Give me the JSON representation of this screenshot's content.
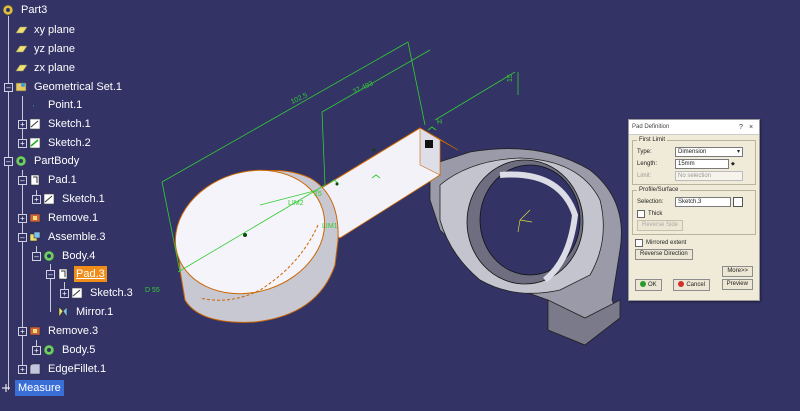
{
  "tree": {
    "items": [
      {
        "label": "Part3"
      },
      {
        "label": "xy plane"
      },
      {
        "label": "yz plane"
      },
      {
        "label": "zx plane"
      },
      {
        "label": "Geometrical Set.1"
      },
      {
        "label": "Point.1"
      },
      {
        "label": "Sketch.1"
      },
      {
        "label": "Sketch.2"
      },
      {
        "label": "PartBody"
      },
      {
        "label": "Pad.1"
      },
      {
        "label": "Sketch.1"
      },
      {
        "label": "Remove.1"
      },
      {
        "label": "Assemble.3"
      },
      {
        "label": "Body.4"
      },
      {
        "label": "Pad.3"
      },
      {
        "label": "Sketch.3"
      },
      {
        "label": "Mirror.1"
      },
      {
        "label": "Remove.3"
      },
      {
        "label": "Body.5"
      },
      {
        "label": "EdgeFillet.1"
      },
      {
        "label": "Measure"
      }
    ]
  },
  "annotations": {
    "dim_total": "102.5",
    "dim_partial": "37.493",
    "dim_height": "15",
    "dim_diameter": "D 55",
    "lim2": "LIM2",
    "lim1": "LIM1",
    "small_15": "15",
    "h_label": "H"
  },
  "dialog": {
    "title": "Pad Definition",
    "help_btn": "?",
    "close_btn": "×",
    "first_limit_legend": "First Limit",
    "type_label": "Type:",
    "type_value": "Dimension",
    "length_label": "Length:",
    "length_value": "15mm",
    "limit_label": "Limit:",
    "limit_value": "No selection",
    "profile_legend": "Profile/Surface",
    "selection_label": "Selection:",
    "selection_value": "Sketch.3",
    "thick_label": "Thick",
    "reverse_side_label": "Reverse Side",
    "mirrored_label": "Mirrored extent",
    "reverse_direction_label": "Reverse Direction",
    "more_label": "More>>",
    "ok_label": "OK",
    "cancel_label": "Cancel",
    "preview_label": "Preview"
  },
  "colors": {
    "background": "#333366",
    "dimension_green": "#33cc33",
    "selected_orange": "#f08c1a",
    "part_face": "#f2f2f8"
  }
}
